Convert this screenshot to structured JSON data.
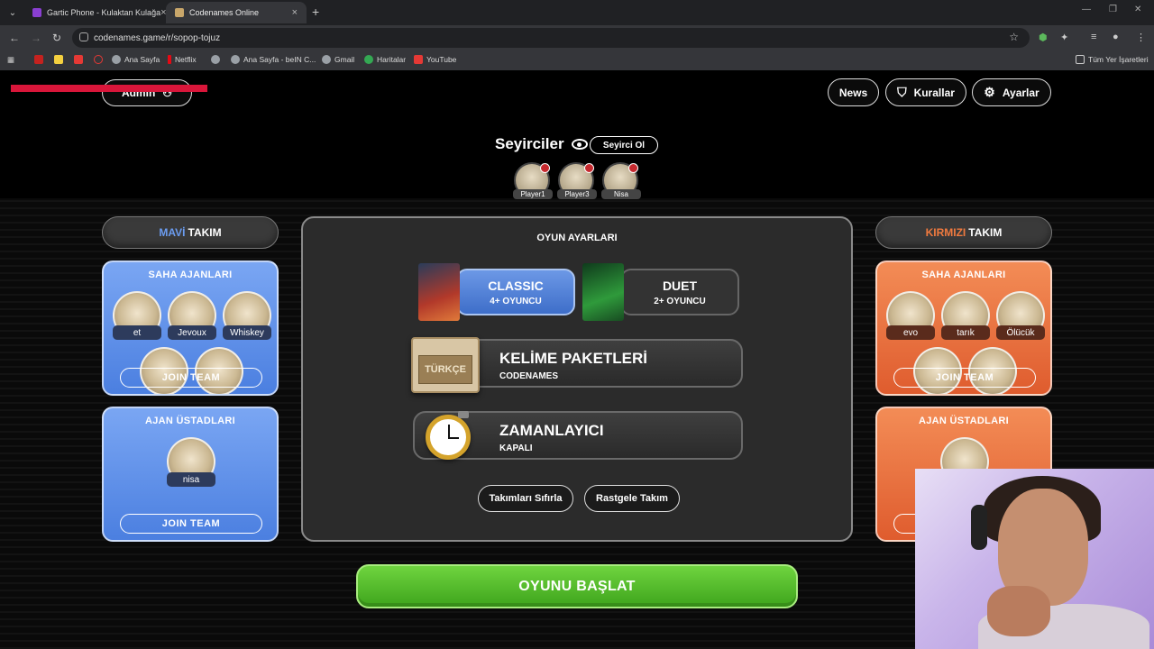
{
  "browser": {
    "tabs": [
      {
        "title": "Gartic Phone - Kulaktan Kulağa",
        "favicon_color": "#8a3fd1"
      },
      {
        "title": "Codenames Online",
        "favicon_color": "#c8a66a"
      }
    ],
    "url": "codenames.game/r/sopop-tojuz",
    "bookmarks": [
      {
        "label": "Ana Sayfa"
      },
      {
        "label": "Netflix"
      },
      {
        "label": "Ana Sayfa - beIN C..."
      },
      {
        "label": "Gmail"
      },
      {
        "label": "Haritalar"
      },
      {
        "label": "YouTube"
      }
    ],
    "all_bookmarks": "Tüm Yer İşaretleri"
  },
  "header": {
    "admin_label": "Admin",
    "news_label": "News",
    "rules_label": "Kurallar",
    "settings_label": "Ayarlar"
  },
  "spectators": {
    "title": "Seyirciler",
    "become_label": "Seyirci Ol",
    "players": [
      "Player1",
      "Player3",
      "Nisa"
    ]
  },
  "blue_team": {
    "title_colored": "MAVİ",
    "title_rest": "TAKIM",
    "color": "#6b9cf0",
    "operatives_title": "SAHA AJANLARI",
    "operatives": [
      "et",
      "Jevoux",
      "Whiskey"
    ],
    "spymasters_title": "AJAN ÜSTADLARI",
    "spymasters": [
      "nisa"
    ],
    "join_label": "JOIN TEAM"
  },
  "red_team": {
    "title_colored": "KIRMIZI",
    "title_rest": "TAKIM",
    "color": "#f07a3f",
    "operatives_title": "SAHA AJANLARI",
    "operatives": [
      "evo",
      "tarık",
      "Ölücük"
    ],
    "spymasters_title": "AJAN ÜSTADLARI",
    "join_label": "JOIN TEAM"
  },
  "game_settings": {
    "title": "OYUN AYARLARI",
    "modes": [
      {
        "name": "CLASSIC",
        "players": "4+ OYUNCU",
        "selected": true
      },
      {
        "name": "DUET",
        "players": "2+ OYUNCU",
        "selected": false
      }
    ],
    "word_packs": {
      "title": "KELİME PAKETLERİ",
      "value": "CODENAMES",
      "pack_label": "TÜRKÇE"
    },
    "timer": {
      "title": "ZAMANLAYICI",
      "value": "KAPALI"
    },
    "reset_teams_label": "Takımları Sıfırla",
    "random_teams_label": "Rastgele Takım"
  },
  "start_label": "OYUNU BAŞLAT"
}
